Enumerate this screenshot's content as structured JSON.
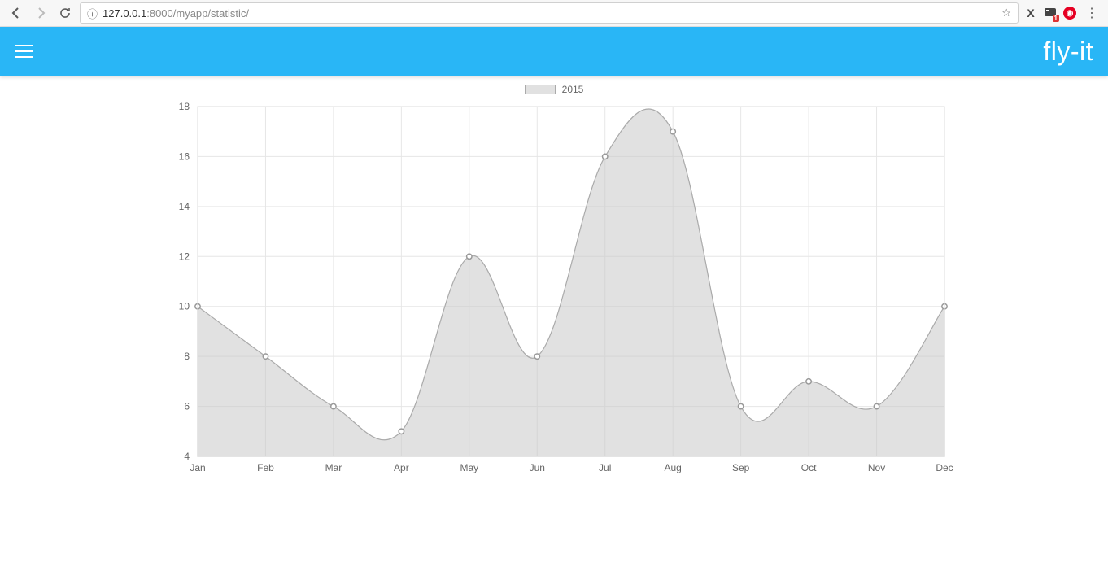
{
  "browser": {
    "url_prefix": "127.0.0.1",
    "url_suffix": ":8000/myapp/statistic/",
    "extension_badge": "1"
  },
  "header": {
    "brand": "fly-it"
  },
  "legend": {
    "label": "2015"
  },
  "chart_data": {
    "type": "area",
    "categories": [
      "Jan",
      "Feb",
      "Mar",
      "Apr",
      "May",
      "Jun",
      "Jul",
      "Aug",
      "Sep",
      "Oct",
      "Nov",
      "Dec"
    ],
    "values": [
      10,
      8,
      6,
      5,
      12,
      8,
      16,
      17,
      6,
      7,
      6,
      10
    ],
    "series_name": "2015",
    "xlabel": "",
    "ylabel": "",
    "ylim": [
      4,
      18
    ],
    "yticks": [
      4,
      6,
      8,
      10,
      12,
      14,
      16,
      18
    ]
  }
}
